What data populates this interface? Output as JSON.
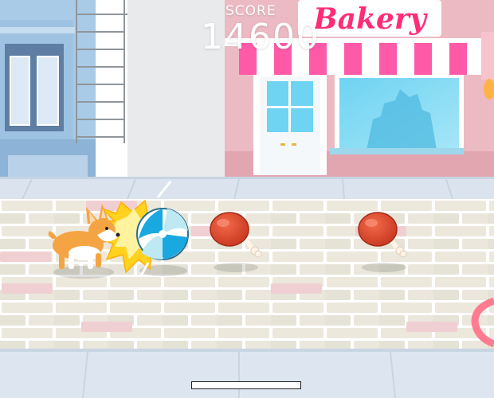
{
  "hud": {
    "score_label": "SCORE",
    "score_value": "14600",
    "progress": 0
  },
  "shop": {
    "sign_text": "Bakery"
  },
  "colors": {
    "sky": "#ffffff",
    "bakery_wall": "#ecbac3",
    "bakery_sign_text": "#ff2d78",
    "awning_pink": "#ff5aa8",
    "sidewalk": "#dbe4ee",
    "brick_street": "#ede9dd",
    "brick_grout": "#ffffff",
    "meat": "#e0452a",
    "beach_ball_blue": "#1aa8e0"
  }
}
